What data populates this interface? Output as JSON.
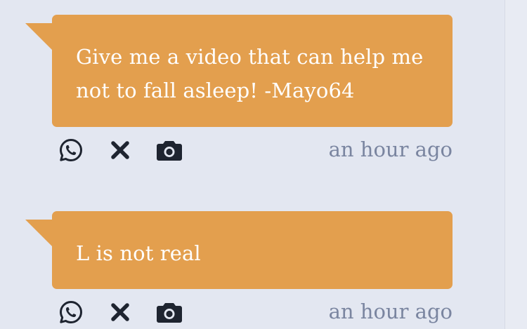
{
  "messages": [
    {
      "text": "Give me a video that can help me not to fall asleep! -Mayo64",
      "timestamp": "an hour ago",
      "icons": [
        "whatsapp-icon",
        "close-icon",
        "camera-icon"
      ]
    },
    {
      "text": "L is not real",
      "timestamp": "an hour ago",
      "icons": [
        "whatsapp-icon",
        "close-icon",
        "camera-icon"
      ]
    }
  ],
  "colors": {
    "background": "#e3e7f1",
    "bubble": "#e39f4e",
    "bubble_text": "#ffffff",
    "icon": "#1e2430",
    "timestamp": "#7a85a0"
  }
}
